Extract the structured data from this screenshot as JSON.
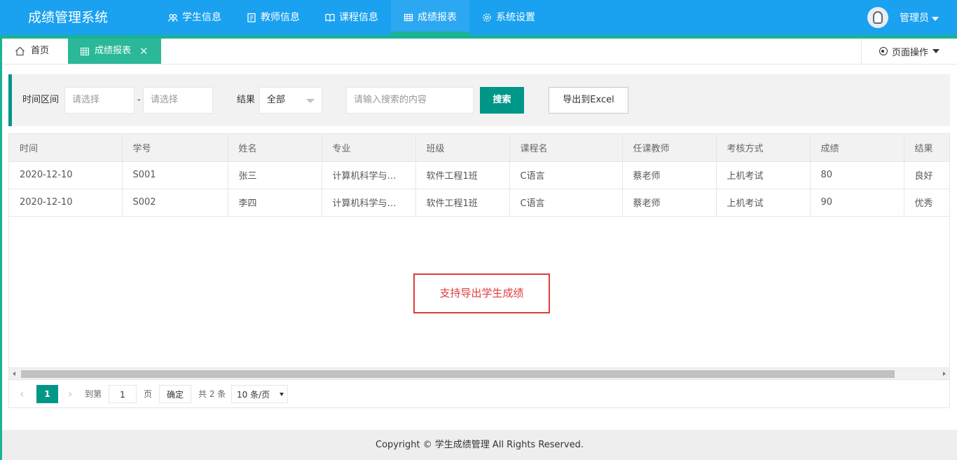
{
  "header": {
    "logo": "成绩管理系统",
    "nav": [
      {
        "label": "学生信息",
        "icon": "users-icon"
      },
      {
        "label": "教师信息",
        "icon": "clipboard-icon"
      },
      {
        "label": "课程信息",
        "icon": "book-icon"
      },
      {
        "label": "成绩报表",
        "icon": "table-icon"
      },
      {
        "label": "系统设置",
        "icon": "gear-icon"
      }
    ],
    "user": "管理员"
  },
  "tabs": {
    "home": "首页",
    "active": "成绩报表",
    "close": "✕",
    "page_ops": "页面操作"
  },
  "search": {
    "time_label": "时间区间",
    "start_placeholder": "请选择",
    "dash": "-",
    "end_placeholder": "请选择",
    "result_label": "结果",
    "result_value": "全部",
    "keyword_placeholder": "请输入搜索的内容",
    "search_button": "搜索",
    "export_button": "导出到Excel"
  },
  "table": {
    "headers": [
      "时间",
      "学号",
      "姓名",
      "专业",
      "班级",
      "课程名",
      "任课教师",
      "考核方式",
      "成绩",
      "结果"
    ],
    "rows": [
      [
        "2020-12-10",
        "S001",
        "张三",
        "计算机科学与…",
        "软件工程1班",
        "C语言",
        "蔡老师",
        "上机考试",
        "80",
        "良好"
      ],
      [
        "2020-12-10",
        "S002",
        "李四",
        "计算机科学与…",
        "软件工程1班",
        "C语言",
        "蔡老师",
        "上机考试",
        "90",
        "优秀"
      ]
    ],
    "callout": "支持导出学生成绩"
  },
  "pager": {
    "prev": "‹",
    "current": "1",
    "next": "›",
    "goto_label": "到第",
    "goto_value": "1",
    "page_unit": "页",
    "confirm": "确定",
    "total": "共 2 条",
    "page_size": "10 条/页"
  },
  "footer": {
    "text": "Copyright © 学生成绩管理 All Rights Reserved."
  }
}
